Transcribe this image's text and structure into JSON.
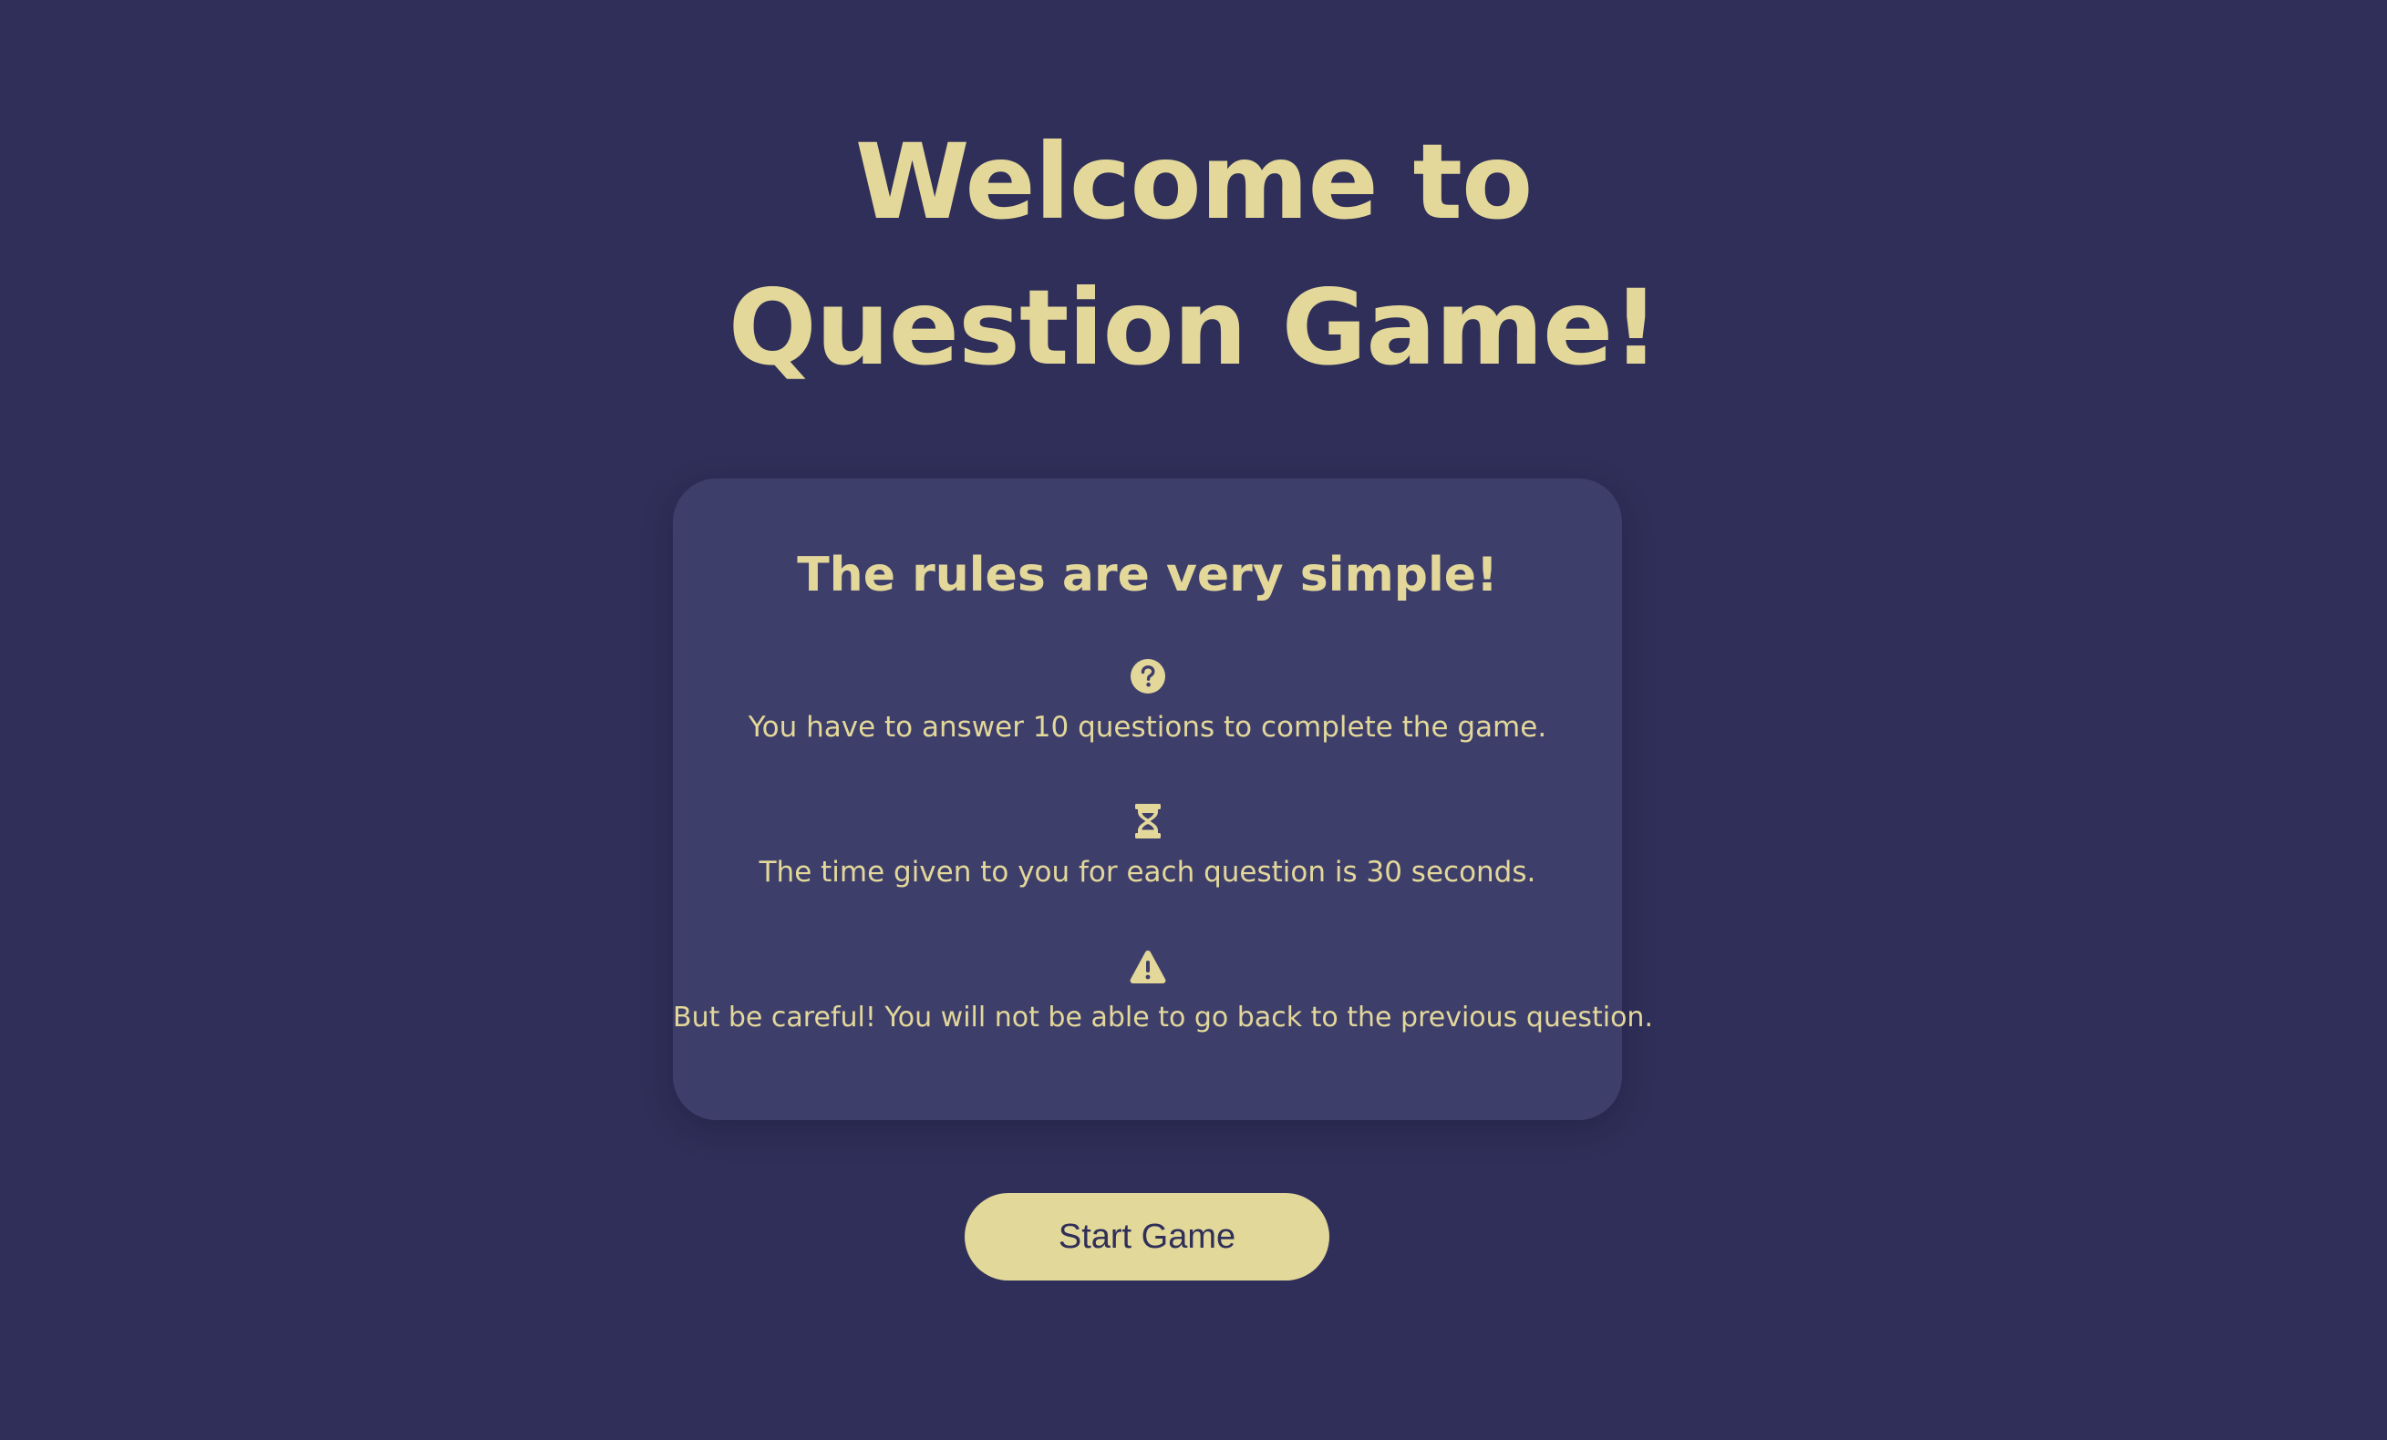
{
  "title": {
    "line1": "Welcome to",
    "line2": "Question Game!"
  },
  "rules": {
    "heading": "The rules are very simple!",
    "items": [
      {
        "icon": "question-circle-icon",
        "text": "You have to answer 10 questions to complete the game."
      },
      {
        "icon": "hourglass-icon",
        "text": "The time given to you for each question is 30 seconds."
      },
      {
        "icon": "warning-icon",
        "text": "But be careful! You will not be able to go back to the previous question."
      }
    ]
  },
  "start_button": {
    "label": "Start Game"
  },
  "colors": {
    "background": "#2f2f59",
    "card": "#3e3e6b",
    "accent": "#e3d89a",
    "button_text": "#2f2f59"
  }
}
